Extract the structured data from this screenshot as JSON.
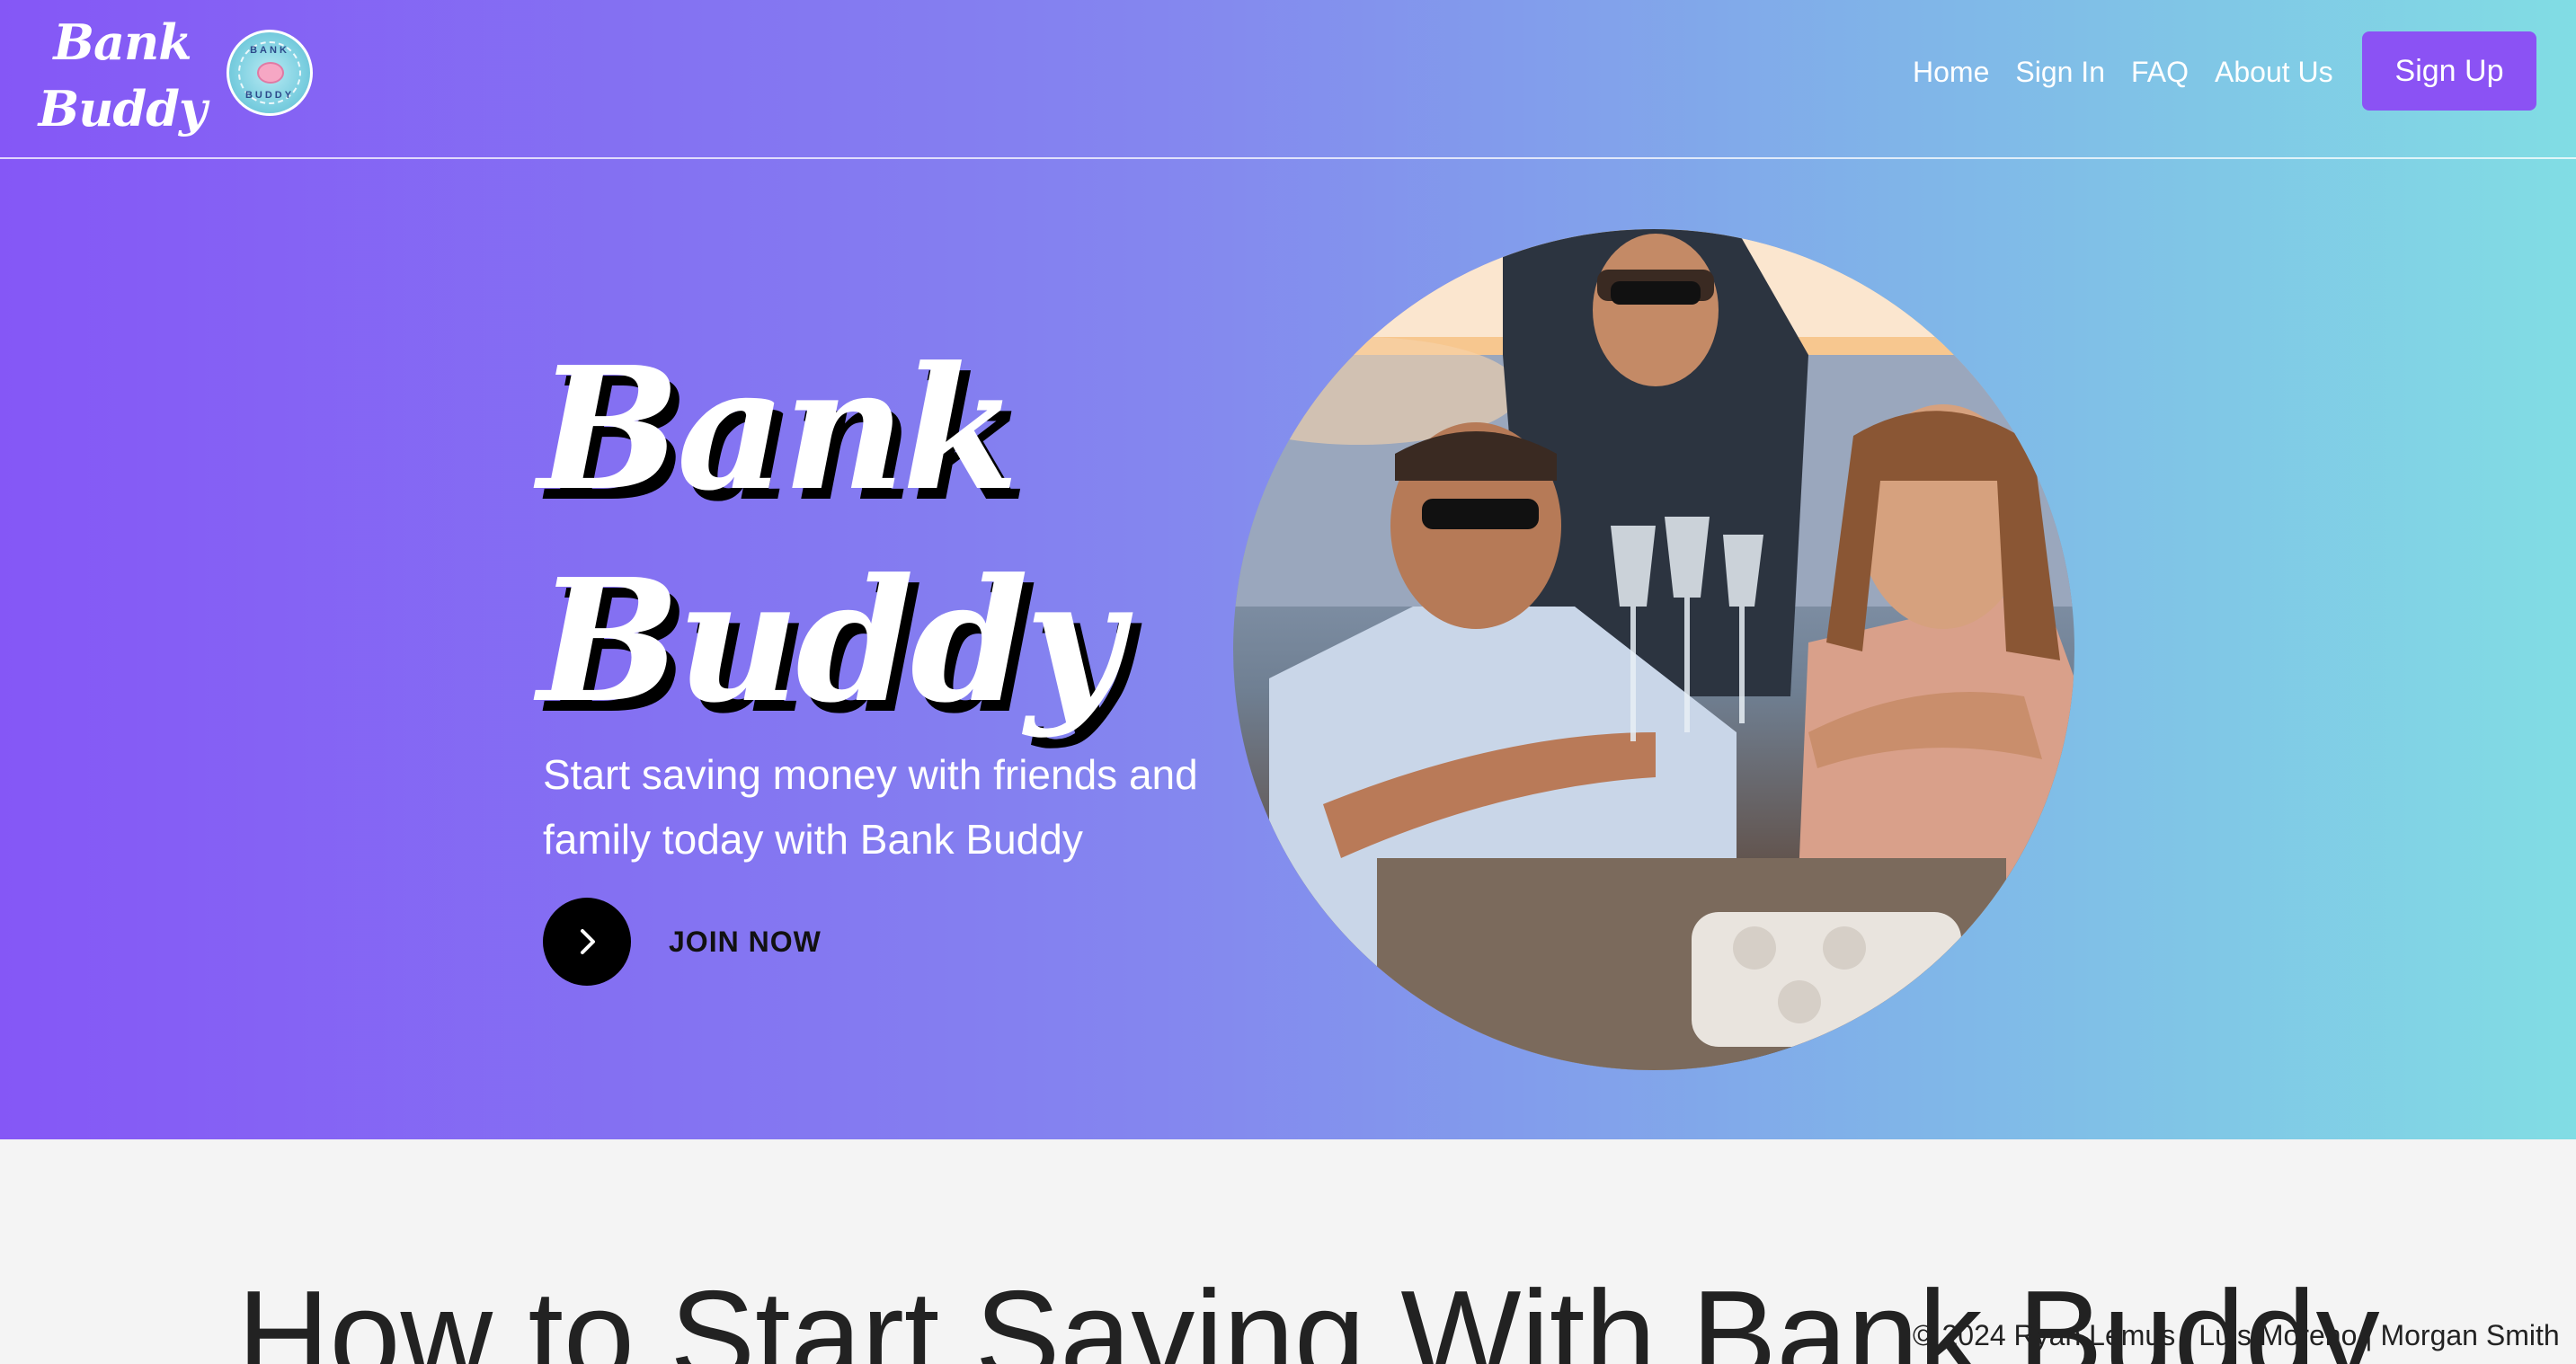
{
  "brand": {
    "logo_line1": "Bank",
    "logo_line2": "Buddy",
    "badge_top": "BANK",
    "badge_bottom": "BUDDY"
  },
  "nav": {
    "links": [
      "Home",
      "Sign In",
      "FAQ",
      "About Us"
    ],
    "signup_label": "Sign Up"
  },
  "hero": {
    "title_line1": "Bank",
    "title_line2": "Buddy",
    "subtitle_line1": "Start saving money with friends and",
    "subtitle_line2": "family today with Bank Buddy",
    "cta_label": "JOIN NOW",
    "cta_icon": "chevron-right-icon"
  },
  "section": {
    "title": "How to Start Saving With Bank Buddy"
  },
  "footer": {
    "credits": "© 2024 Ryan Lemus | Luis Moreno | Morgan Smith"
  },
  "colors": {
    "gradient_start": "#8557f6",
    "gradient_end": "#81dde4",
    "button_purple": "#8b52f4",
    "page_bg": "#f4f4f4"
  }
}
